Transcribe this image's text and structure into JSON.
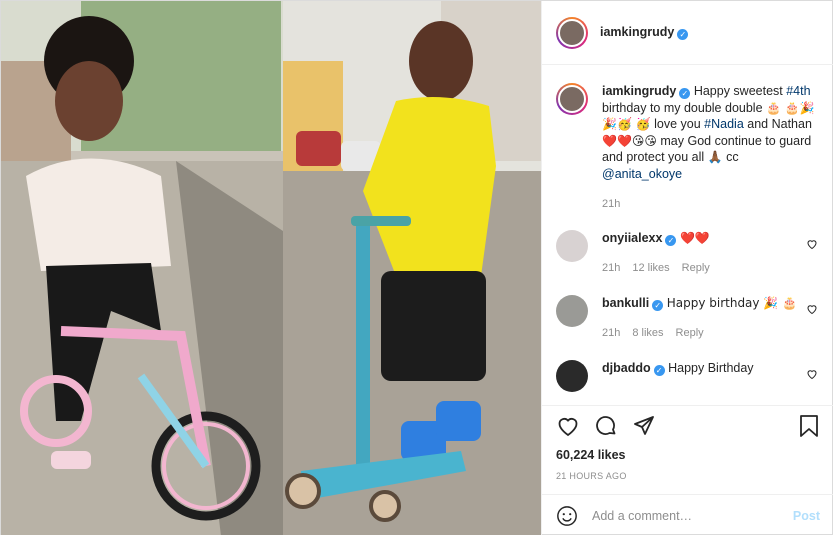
{
  "post": {
    "author": "iamkingrudy",
    "caption": {
      "username": "iamkingrudy",
      "text_1": "Happy sweetest",
      "hashtag_1": "#4th",
      "text_2": "birthday to my double double",
      "emoji_line": "🎂 🎂🎉🎉🥳 🥳",
      "text_3": "love you",
      "hashtag_2": "#Nadia",
      "text_4": "and Nathan",
      "emoji_2": "❤️❤️😘😘",
      "text_5": "may God continue to guard and protect you all",
      "emoji_3": "🙏🏾",
      "text_6": "cc",
      "mention": "@anita_okoye",
      "time": "21h"
    },
    "comments": [
      {
        "username": "onyiialexx",
        "text": "❤️❤️",
        "time": "21h",
        "likes": "12 likes",
        "reply": "Reply"
      },
      {
        "username": "bankulli",
        "text": "Happy birthday 🎉 🎂",
        "time": "21h",
        "likes": "8 likes",
        "reply": "Reply"
      },
      {
        "username": "djbaddo",
        "text": "Happy Birthday"
      }
    ],
    "likes": "60,224 likes",
    "posted_ago": "21 HOURS AGO",
    "add_comment_placeholder": "Add a comment…",
    "post_label": "Post"
  },
  "colors": {
    "link": "#00376b",
    "verified": "#3897f0",
    "muted": "#8e8e8e",
    "post_disabled": "#b2dffc"
  },
  "icons": [
    "verified-badge-icon",
    "heart-icon",
    "comment-icon",
    "share-icon",
    "bookmark-icon",
    "smiley-icon"
  ]
}
